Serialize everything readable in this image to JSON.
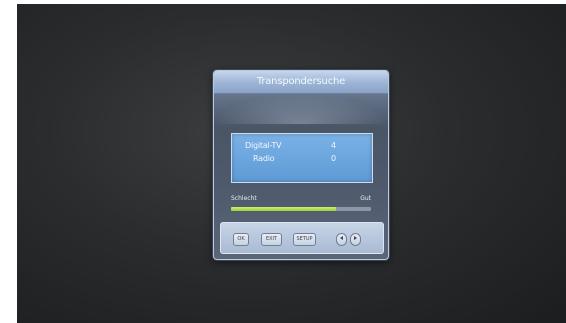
{
  "dialog": {
    "title": "Transpondersuche",
    "results": [
      {
        "label": "Digital-TV",
        "value": "4"
      },
      {
        "label": "Radio",
        "value": "0"
      }
    ],
    "signal": {
      "weak_label": "Schlecht",
      "good_label": "Gut",
      "level": 0.75
    },
    "buttons": {
      "ok": "OK",
      "exit": "EXIT",
      "setup": "SETUP"
    }
  },
  "colors": {
    "title_bar": "#9fb6d6",
    "results_panel": "#6aa6de",
    "signal_fill": "#a8dc48"
  },
  "icons": {
    "left": "arrow-left-icon",
    "right": "arrow-right-icon"
  }
}
